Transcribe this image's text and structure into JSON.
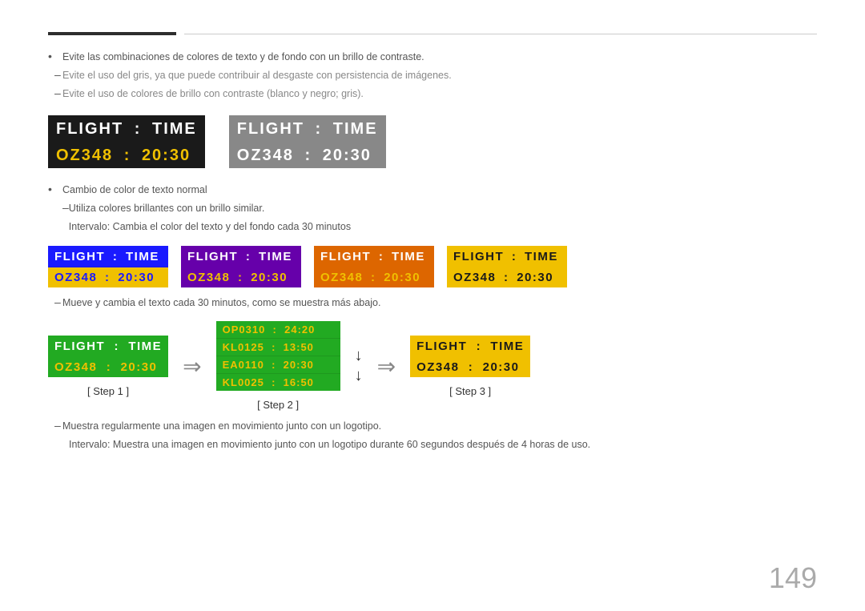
{
  "topBar": {},
  "bullets1": [
    {
      "type": "dot",
      "text": "Evite las combinaciones de colores de texto y de fondo con un brillo de contraste."
    },
    {
      "type": "dash",
      "text": "Evite el uso del gris, ya que puede contribuir al desgaste con persistencia de imágenes."
    },
    {
      "type": "dash",
      "text": "Evite el uso de colores de brillo con contraste (blanco y negro; gris)."
    }
  ],
  "flightBoxes": {
    "box1": {
      "row1": {
        "label": "FLIGHT",
        "colon": ":",
        "label2": "TIME"
      },
      "row2": {
        "label": "OZ348",
        "colon": ":",
        "label2": "20:30"
      },
      "variant": "dark"
    },
    "box2": {
      "row1": {
        "label": "FLIGHT",
        "colon": ":",
        "label2": "TIME"
      },
      "row2": {
        "label": "OZ348",
        "colon": ":",
        "label2": "20:30"
      },
      "variant": "grey"
    }
  },
  "bullets2": {
    "main": "Cambio de color de texto normal",
    "sub1": "Utiliza colores brillantes con un brillo similar.",
    "sub2": "Intervalo: Cambia el color del texto y del fondo cada 30 minutos"
  },
  "colorBoxes": [
    {
      "id": "blue",
      "r1l": "FLIGHT",
      "r1c": ":",
      "r1r": "TIME",
      "r2l": "OZ348",
      "r2c": ":",
      "r2r": "20:30"
    },
    {
      "id": "purple",
      "r1l": "FLIGHT",
      "r1c": ":",
      "r1r": "TIME",
      "r2l": "OZ348",
      "r2c": ":",
      "r2r": "20:30"
    },
    {
      "id": "orange",
      "r1l": "FLIGHT",
      "r1c": ":",
      "r1r": "TIME",
      "r2l": "OZ348",
      "r2c": ":",
      "r2r": "20:30"
    },
    {
      "id": "yellow",
      "r1l": "FLIGHT",
      "r1c": ":",
      "r1r": "TIME",
      "r2l": "OZ348",
      "r2c": ":",
      "r2r": "20:30"
    }
  ],
  "bulletDash2": "Mueve y cambia el texto cada 30 minutos, como se muestra más abajo.",
  "steps": {
    "step1": {
      "r1": "FLIGHT   :   TIME",
      "r2": "OZ348   :   20:30",
      "label": "[ Step 1 ]"
    },
    "step2": {
      "rows": [
        "OP0310  :  24:20",
        "KL0125  :  13:50",
        "EA0110  :  20:30",
        "KL0025  :  16:50"
      ],
      "label": "[ Step 2 ]"
    },
    "step3": {
      "r1": "FLIGHT   :   TIME",
      "r2": "OZ348   :   20:30",
      "label": "[ Step 3 ]"
    }
  },
  "bullets3": {
    "dash1": "Muestra regularmente una imagen en movimiento junto con un logotipo.",
    "dash2": "Intervalo: Muestra una imagen en movimiento junto con un logotipo durante 60 segundos después de 4 horas de uso."
  },
  "pageNumber": "149"
}
